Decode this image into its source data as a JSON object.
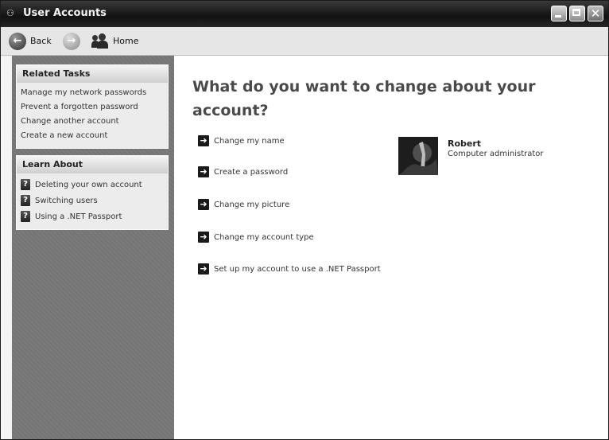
{
  "window": {
    "title": "User Accounts",
    "icon": "user-accounts-icon"
  },
  "toolbar": {
    "back_label": "Back",
    "forward_icon": "forward-arrow-icon",
    "home_label": "Home"
  },
  "sidebar": {
    "related_tasks": {
      "title": "Related Tasks",
      "items": [
        "Manage my network passwords",
        "Prevent a forgotten password",
        "Change another account",
        "Create a new account"
      ]
    },
    "learn_about": {
      "title": "Learn About",
      "items": [
        "Deleting your own account",
        "Switching users",
        "Using a .NET Passport"
      ]
    }
  },
  "main": {
    "heading": "What do you want to change about your account?",
    "actions": [
      "Change my name",
      "Create a password",
      "Change my picture",
      "Change my account type",
      "Set up my account to use a .NET Passport"
    ]
  },
  "user": {
    "name": "Robert",
    "role": "Computer administrator"
  }
}
